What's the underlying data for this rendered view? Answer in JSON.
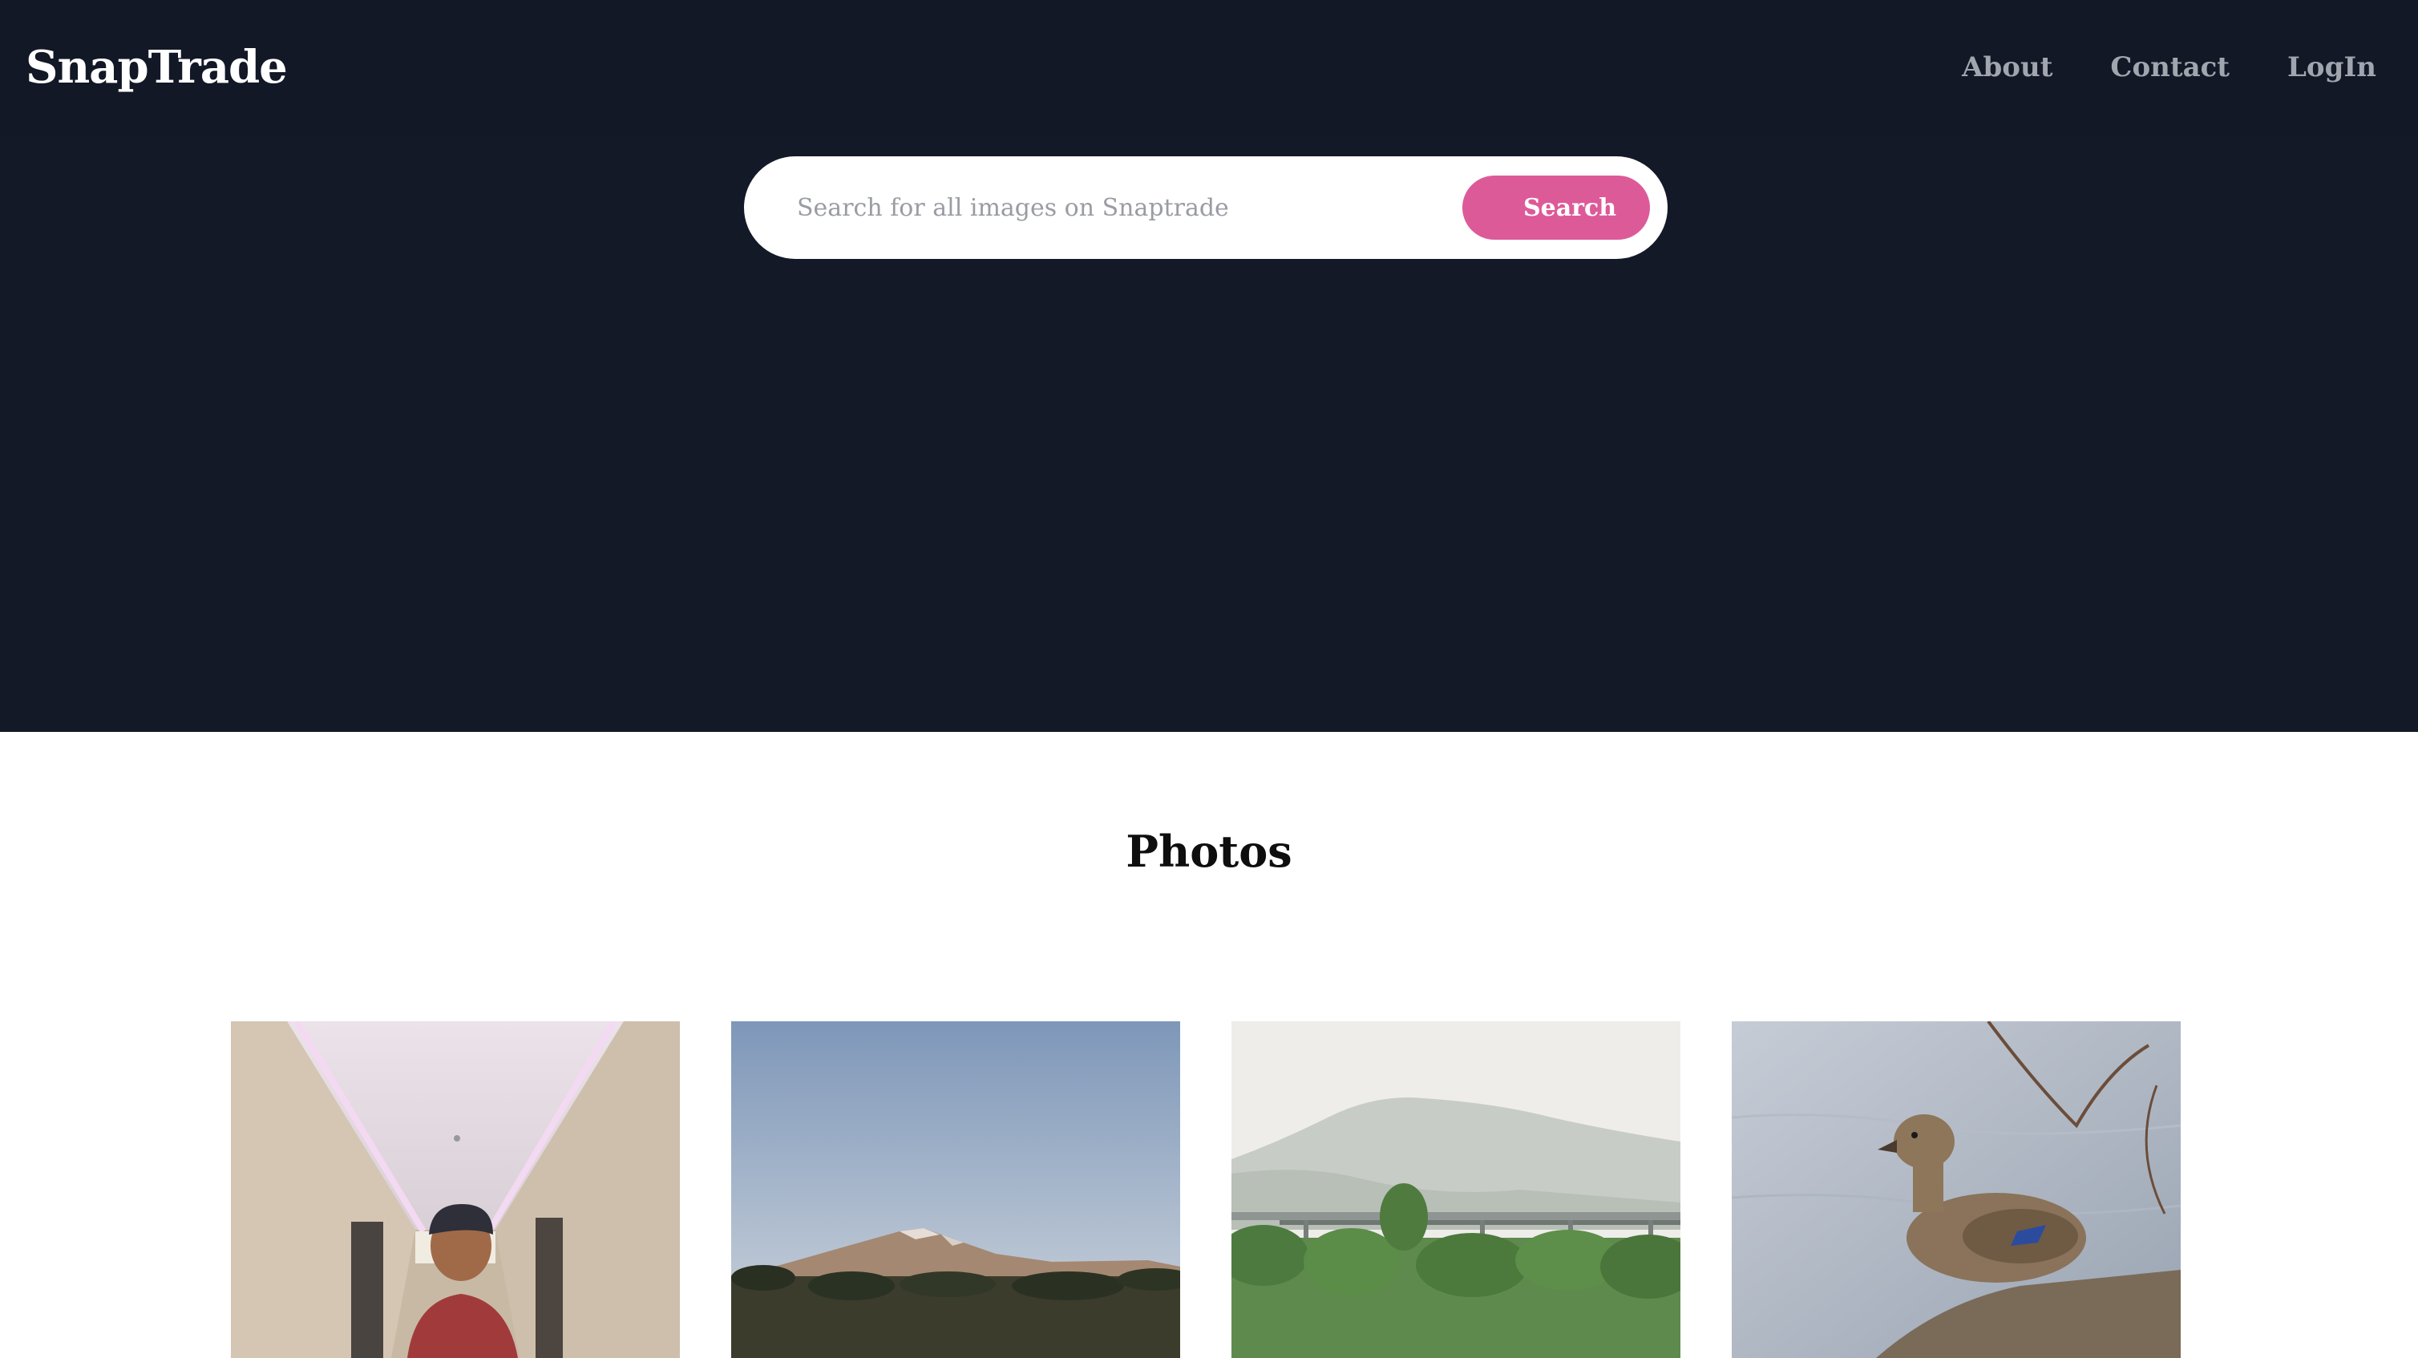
{
  "app": {
    "brand": "SnapTrade"
  },
  "nav": {
    "items": [
      {
        "label": "About"
      },
      {
        "label": "Contact"
      },
      {
        "label": "LogIn"
      }
    ]
  },
  "search": {
    "placeholder": "Search for all images on Snaptrade",
    "value": "",
    "button_label": "Search"
  },
  "main": {
    "title": "Photos",
    "photos": [
      {
        "subject": "man-in-hallway"
      },
      {
        "subject": "mountain-landscape"
      },
      {
        "subject": "misty-hills-bridge"
      },
      {
        "subject": "duck-on-water"
      }
    ]
  },
  "colors": {
    "hero_bg": "#141927",
    "accent": "#dd5a99",
    "nav_text": "#a1a5ae"
  }
}
